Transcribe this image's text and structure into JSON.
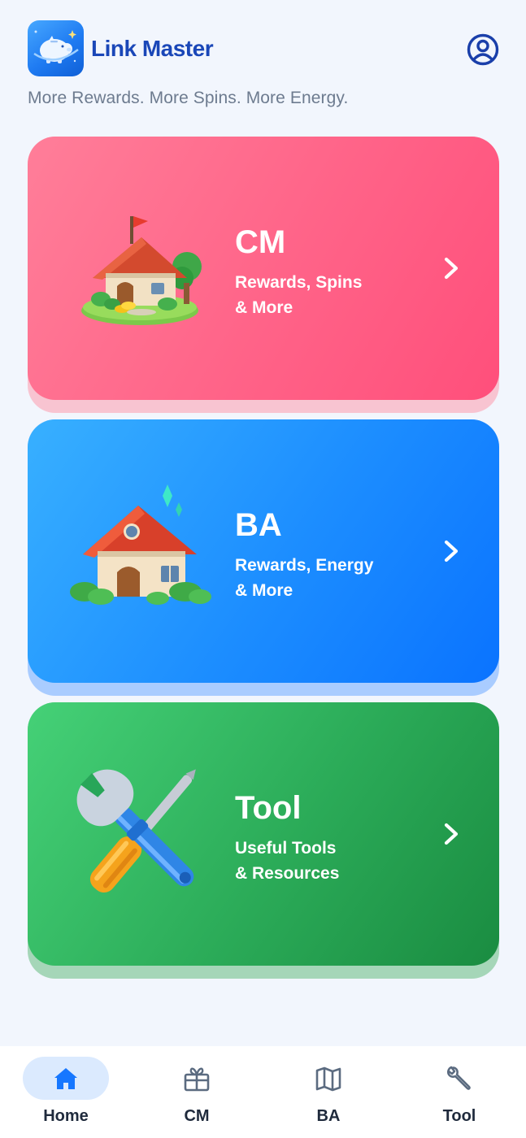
{
  "header": {
    "app_name": "Link Master",
    "tagline": "More Rewards. More Spins. More Energy."
  },
  "cards": [
    {
      "title": "CM",
      "subtitle_line1": "Rewards, Spins",
      "subtitle_line2": "& More",
      "color": "#ff6388",
      "icon": "cottage-house-icon"
    },
    {
      "title": "BA",
      "subtitle_line1": "Rewards, Energy",
      "subtitle_line2": "& More",
      "color": "#1c8dff",
      "icon": "house-icon"
    },
    {
      "title": "Tool",
      "subtitle_line1": "Useful Tools",
      "subtitle_line2": "& Resources",
      "color": "#2bab58",
      "icon": "wrench-screwdriver-icon"
    }
  ],
  "bottom_nav": {
    "items": [
      {
        "label": "Home",
        "icon": "home-icon",
        "active": true
      },
      {
        "label": "CM",
        "icon": "gift-icon",
        "active": false
      },
      {
        "label": "BA",
        "icon": "map-icon",
        "active": false
      },
      {
        "label": "Tool",
        "icon": "wrench-icon",
        "active": false
      }
    ],
    "active_color": "#1677ff",
    "inactive_color": "#5b6b80"
  }
}
